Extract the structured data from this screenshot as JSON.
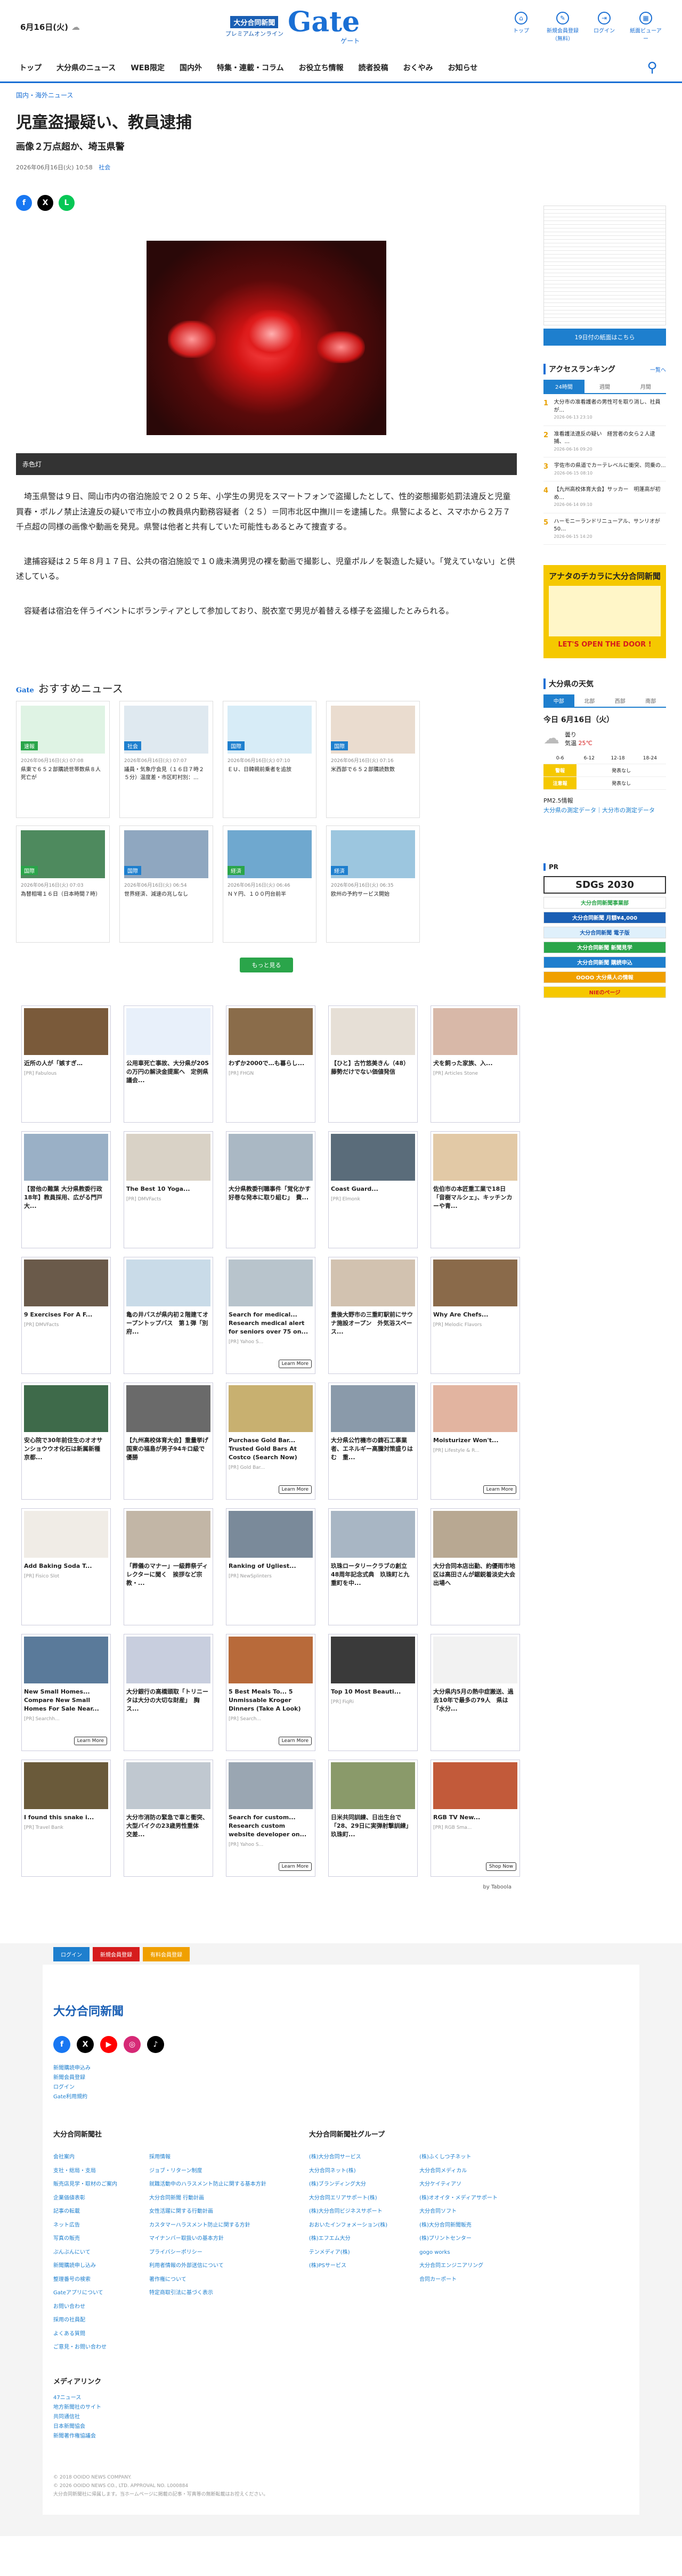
{
  "header": {
    "date": "6月16日(火)",
    "weather_icon": "cloud-icon",
    "logo_paper": "大分合同新聞",
    "logo_premium": "プレミアムオンライン",
    "logo_gate": "Gate",
    "logo_gate_kana": "ゲート",
    "icons": [
      {
        "name": "home-icon",
        "label": "トップ",
        "glyph": "⌂"
      },
      {
        "name": "subscribe-icon",
        "label": "新規会員登録（無料）",
        "glyph": "✎"
      },
      {
        "name": "login-icon",
        "label": "ログイン",
        "glyph": "⇥"
      },
      {
        "name": "paper-icon",
        "label": "紙面ビューアー",
        "glyph": "▦"
      }
    ]
  },
  "nav": [
    "トップ",
    "大分県のニュース",
    "WEB限定",
    "国内外",
    "特集・連載・コラム",
    "お役立ち情報",
    "読者投稿",
    "おくやみ",
    "お知らせ"
  ],
  "article": {
    "breadcrumb": "国内・海外ニュース",
    "title": "児童盗撮疑い、教員逮捕",
    "subtitle": "画像２万点超か、埼玉県警",
    "date": "2026年06月16日(火) 10:58",
    "category": "社会",
    "caption": "赤色灯",
    "paragraphs": [
      "埼玉県警は９日、岡山市内の宿泊施設で２０２５年、小学生の男児をスマートフォンで盗撮したとして、性的姿態撮影処罰法違反と児童買春・ポルノ禁止法違反の疑いで市立小の教員県内勤務容疑者（２５）＝同市北区中撫川＝を逮捕した。県警によると、スマホから２万７千点超の同様の画像や動画を発見。県警は他者と共有していた可能性もあるとみて捜査する。",
      "逮捕容疑は２５年８月１７日、公共の宿泊施設で１０歳未満男児の裸を動画で撮影し、児童ポルノを製造した疑い。「覚えていない」と供述している。",
      "容疑者は宿泊を伴うイベントにボランティアとして参加しており、脱衣室で男児が着替える様子を盗撮したとみられる。"
    ]
  },
  "recommend": {
    "gate_label": "Gate",
    "title": "おすすめニュース",
    "more_label": "もっと見る",
    "items": [
      {
        "tag": "速報",
        "date": "2026年06月16日(火) 07:08",
        "title": "県東で６５２部購読世帯数県８人死亡が",
        "color": "#2aa54a",
        "bg": "#dff3e4"
      },
      {
        "tag": "社会",
        "date": "2026年06月16日(火) 07:07",
        "title": "議員・気象庁会見（１６日７時２５分）温度差・市区町村別：...",
        "color": "#1e7fce",
        "bg": "#dfe9f0"
      },
      {
        "tag": "国際",
        "date": "2026年06月16日(火) 07:10",
        "title": "ＥＵ、日韓親前乗者を追放",
        "color": "#1e7fce",
        "bg": "#d7ecf7"
      },
      {
        "tag": "国際",
        "date": "2026年06月16日(火) 07:16",
        "title": "米西部で６５２部購読数数",
        "color": "#1e7fce",
        "bg": "#eadccf"
      },
      {
        "tag": "国際",
        "date": "2026年06月16日(火) 07:03",
        "title": "為替相場１６日（日本時間７時）",
        "color": "#2aa54a",
        "bg": "#4e8a5e"
      },
      {
        "tag": "国際",
        "date": "2026年06月16日(火) 06:54",
        "title": "世界経済、減速の兆しなし",
        "color": "#1e7fce",
        "bg": "#8fa7c0"
      },
      {
        "tag": "経済",
        "date": "2026年06月16日(火) 06:46",
        "title": "ＮＹ円、１００円台前半",
        "color": "#2aa54a",
        "bg": "#6fa8cf"
      },
      {
        "tag": "経済",
        "date": "2026年06月16日(火) 06:35",
        "title": "欧州の予約サービス開始",
        "color": "#1e7fce",
        "bg": "#9cc6df"
      }
    ]
  },
  "ads": [
    {
      "title": "近所の人が「嫉すぎ…",
      "source": "[PR] Fabulous",
      "bg": "#7a5a3a",
      "lm": ""
    },
    {
      "title": "公用車死亡事故、大分県が205の万円の解決金提案へ　定例県議会...",
      "source": "",
      "bg": "#e8f0fa",
      "lm": ""
    },
    {
      "title": "わずか2000で…も暮らし...",
      "source": "[PR] FHGN",
      "bg": "#8a6c4a",
      "lm": ""
    },
    {
      "title": "【ひと】古竹悠美きん（48）　藤勢だけでない価値発信",
      "source": "",
      "bg": "#e6dfd6",
      "lm": ""
    },
    {
      "title": "犬を飼った家族、入...",
      "source": "[PR] Articles Stone",
      "bg": "#d8b8a8",
      "lm": ""
    },
    {
      "title": "【習他の難葉 大分県教委行政18年】教員採用、広がる門戸　大...",
      "source": "",
      "bg": "#9ab0c6",
      "lm": ""
    },
    {
      "title": "The Best 10 Yoga...",
      "source": "[PR] DMVFacts",
      "bg": "#d9d2c6",
      "lm": ""
    },
    {
      "title": "大分県教委刊職事件「覚化かす好巻な発本に取り組む」　費...",
      "source": "",
      "bg": "#aab8c4",
      "lm": ""
    },
    {
      "title": "Coast Guard...",
      "source": "[PR] Elmonk",
      "bg": "#5a6c7a",
      "lm": ""
    },
    {
      "title": "佐伯市の本匠重工業で18日「音樹マルシェ」、キッチンカーや青...",
      "source": "",
      "bg": "#e2c9a6",
      "lm": ""
    },
    {
      "title": "9 Exercises For A F...",
      "source": "[PR] DMVFacts",
      "bg": "#6a5a4a",
      "lm": ""
    },
    {
      "title": "亀の井バスが県内初２階建てオープントップバス　第１弾「別府...",
      "source": "",
      "bg": "#c9dbe8",
      "lm": ""
    },
    {
      "title": "Search for medical... Research medical alert for seniors over 75 on...",
      "source": "[PR] Yahoo S...",
      "bg": "#b8c4cc",
      "lm": "Learn More"
    },
    {
      "title": "豊後大野市の三重町駅前にサウナ施設オープン　外気浴スペース...",
      "source": "",
      "bg": "#d2c2b0",
      "lm": ""
    },
    {
      "title": "Why Are Chefs...",
      "source": "[PR] Melodic Flavors",
      "bg": "#8a6a4a",
      "lm": ""
    },
    {
      "title": "安心院で30年前住生のオオサンショウウオ化石は新属新種　京都...",
      "source": "",
      "bg": "#3e6a4a",
      "lm": ""
    },
    {
      "title": "【九州高校体育大会】重量挙げ　国東の福島が男子94キロ級で優勝",
      "source": "",
      "bg": "#6a6a6a",
      "lm": ""
    },
    {
      "title": "Purchase Gold Bar... Trusted Gold Bars At Costco (Search Now)",
      "source": "[PR] Gold Bar...",
      "bg": "#c8b070",
      "lm": "Learn More"
    },
    {
      "title": "大分県公竹機市の鋳石工事業者、エネルギー高騰対策盛りはむ　重...",
      "source": "",
      "bg": "#8a9aaa",
      "lm": ""
    },
    {
      "title": "Moisturizer Won't...",
      "source": "[PR] Lifestyle & R...",
      "bg": "#e2b4a0",
      "lm": "Learn More"
    },
    {
      "title": "Add Baking Soda T...",
      "source": "[PR] Fisico Slot",
      "bg": "#f0ece6",
      "lm": ""
    },
    {
      "title": "「葬儀のマナー」一級葬祭ディレクターに聞く　挨拶など宗教・...",
      "source": "",
      "bg": "#c2b6a6",
      "lm": ""
    },
    {
      "title": "Ranking of Ugliest...",
      "source": "[PR] NewSplinters",
      "bg": "#7a8a9a",
      "lm": ""
    },
    {
      "title": "玖珠ロータリークラブの創立48周年記念式典　玖珠町と九重町を中...",
      "source": "",
      "bg": "#a8b6c4",
      "lm": ""
    },
    {
      "title": "大分合同本店出勤、約優雨市地区は高田さんが鋸鋭着淡史大会出場へ",
      "source": "",
      "bg": "#b8a892",
      "lm": ""
    },
    {
      "title": "New Small Homes... Compare New Small Homes For Sale Near...",
      "source": "[PR] Searchh...",
      "bg": "#5a7a9a",
      "lm": "Learn More"
    },
    {
      "title": "大分銀行の高橋頭取「トリニータは大分の大切な財産」　胸ス...",
      "source": "",
      "bg": "#c8cede",
      "lm": ""
    },
    {
      "title": "5 Best Meals To... 5 Unmissable Kroger Dinners (Take A Look)",
      "source": "[PR] Search...",
      "bg": "#b86a3a",
      "lm": "Learn More"
    },
    {
      "title": "Top 10 Most Beauti...",
      "source": "[PR] FiqRi",
      "bg": "#3a3a3a",
      "lm": ""
    },
    {
      "title": "大分県内5月の熱中症搬送、過去10年で最多の79人　県は「水分...",
      "source": "",
      "bg": "#f2f2f2",
      "lm": ""
    },
    {
      "title": "I found this snake i...",
      "source": "[PR] Travel Bank",
      "bg": "#6a5a3a",
      "lm": ""
    },
    {
      "title": "大分市消防の緊急で車と衝突、大型バイクの23歳男性重体　交差...",
      "source": "",
      "bg": "#c0c8d0",
      "lm": ""
    },
    {
      "title": "Search for custom... Research custom website developer on...",
      "source": "[PR] Yahoo S...",
      "bg": "#9aa6b2",
      "lm": "Learn More"
    },
    {
      "title": "日米共同訓練、日出生台で「28、29日に実弾射撃訓練」　玖珠町...",
      "source": "",
      "bg": "#8a9a6a",
      "lm": ""
    },
    {
      "title": "RGB TV New...",
      "source": "[PR] RGB Sma...",
      "bg": "#c25a3a",
      "lm": "Shop Now"
    }
  ],
  "taboola": "by Taboola",
  "side": {
    "paper_btn": "19日付の紙面はこちら",
    "rank_title": "アクセスランキング",
    "rank_more": "一覧へ",
    "rank_tabs": [
      "24時間",
      "週間",
      "月間"
    ],
    "rank_items": [
      {
        "n": "1",
        "t": "大分市の准看護者の男性可を取り消し、社員が...",
        "d": "2026-06-13 23:10"
      },
      {
        "n": "2",
        "t": "准看護法違反の疑い　経営者の女ら２人逮捕、...",
        "d": "2026-06-16 09:20"
      },
      {
        "n": "3",
        "t": "宇佐市の県道でカーテレベルに衝突、同乗の...",
        "d": "2026-06-15 08:10"
      },
      {
        "n": "4",
        "t": "【九州高校体育大会】サッカー　明蓬高が初め...",
        "d": "2026-06-14 09:10"
      },
      {
        "n": "5",
        "t": "ハーモニーランドリニューアル、サンリオが50…",
        "d": "2026-06-15 14:20"
      }
    ],
    "banner_head": "アナタのチカラに大分合同新聞",
    "banner_foot": "LET'S OPEN THE DOOR !",
    "weather_title": "大分県の天気",
    "weather_tabs": [
      "中部",
      "北部",
      "西部",
      "南部"
    ],
    "weather_today": "今日 6月16日（火）",
    "weather_text": "曇り",
    "weather_hi": "25℃",
    "weather_lo": "",
    "weather_times": [
      "0-6",
      "6-12",
      "12-18",
      "18-24"
    ],
    "weather_rows": [
      {
        "label": "警報",
        "value": "発表なし"
      },
      {
        "label": "注意報",
        "value": "発表なし"
      }
    ],
    "pm_title": "PM2.5情報",
    "pm_link": "大分県の測定データ｜大分市の測定データ",
    "pr_title": "PR",
    "sdgs": "SDGs 2030",
    "pr_items": [
      {
        "label": "大分合同新聞事業部",
        "bg": "#fff",
        "fg": "#2aa54a"
      },
      {
        "label": "大分合同新聞 月額¥4,000",
        "bg": "#1a5fb4",
        "fg": "#fff"
      },
      {
        "label": "大分合同新聞 電子版",
        "bg": "#dff0fb",
        "fg": "#1a5fb4"
      },
      {
        "label": "大分合同新聞 新聞見学",
        "bg": "#2aa54a",
        "fg": "#fff"
      },
      {
        "label": "大分合同新聞 購読申込",
        "bg": "#1e7fce",
        "fg": "#fff"
      },
      {
        "label": "OOOO 大分県人の情報",
        "bg": "#f0a000",
        "fg": "#fff"
      },
      {
        "label": "NIEのページ",
        "bg": "#f5c800",
        "fg": "#d61c1c"
      }
    ]
  },
  "footer": {
    "buttons": [
      "ログイン",
      "新規会員登録",
      "有料会員登録"
    ],
    "logo": "大分合同新聞",
    "small_links": [
      "新聞購読申込み",
      "新聞会員登録",
      "ログイン",
      "Gate利用規約"
    ],
    "col1_title": "大分合同新聞社",
    "col1a": [
      "会社案内",
      "支社・総局・支局",
      "販売店見学・取材のご案内",
      "企業価値表彰",
      "記事の転載",
      "ネット広告",
      "写真の販売",
      "ぶんぶんにいて",
      "新聞購読申し込み",
      "整理番号の検索",
      "Gateアプリについて",
      "お問い合わせ",
      "採用の社員配",
      "よくある質問",
      "ご意見・お問い合わせ"
    ],
    "col1b": [
      "採用情報",
      "ジョブ・リターン制度",
      "就職活動中のハラスメント防止に関する基本方針",
      "大分合同新聞 行動計画",
      "女性活躍に関する行動計画",
      "カスタマーハラスメント防止に関する方針",
      "マイナンバー取扱いの基本方針",
      "プライバシーポリシー",
      "利用者情報の外部送信について",
      "著作権について",
      "特定商取引法に基づく表示"
    ],
    "col2_title": "大分合同新聞社グループ",
    "col2a": [
      "(株)大分合同サービス",
      "大分合同ネット(株)",
      "(株)ブランディング大分",
      "大分合同エリアサポート(株)",
      "(株)大分合同ビジネスサポート",
      "おおいたインフォメーション(株)",
      "(株)エフエム大分",
      "テンメディア(株)",
      "(株)PSサービス"
    ],
    "col2b": [
      "(株)ふくしつ子ネット",
      "大分合同メディカル",
      "大分ケイティアソ",
      "(株)オオイタ・メディアサポート",
      "大分合同ソフト",
      "(株)大分合同新聞販売",
      "(株)プリントセンター",
      "gogo works",
      "大分合同エンジニアリング",
      "合同カーポート"
    ],
    "media_title": "メディアリンク",
    "media_links": [
      "47ニュース",
      "地方新聞社のサイト",
      "共同通信社",
      "日本新聞協会",
      "新聞著作権協議会"
    ],
    "copy1": "© 2018 OOIDO NEWS COMPANY.",
    "copy2": "© 2026 OOIDO NEWS CO., LTD. APPROVAL NO. L000884",
    "copy3": "大分合同新聞社に帰属します。当ホームページに掲載の記事・写真等の無断転載はお控えください。"
  }
}
